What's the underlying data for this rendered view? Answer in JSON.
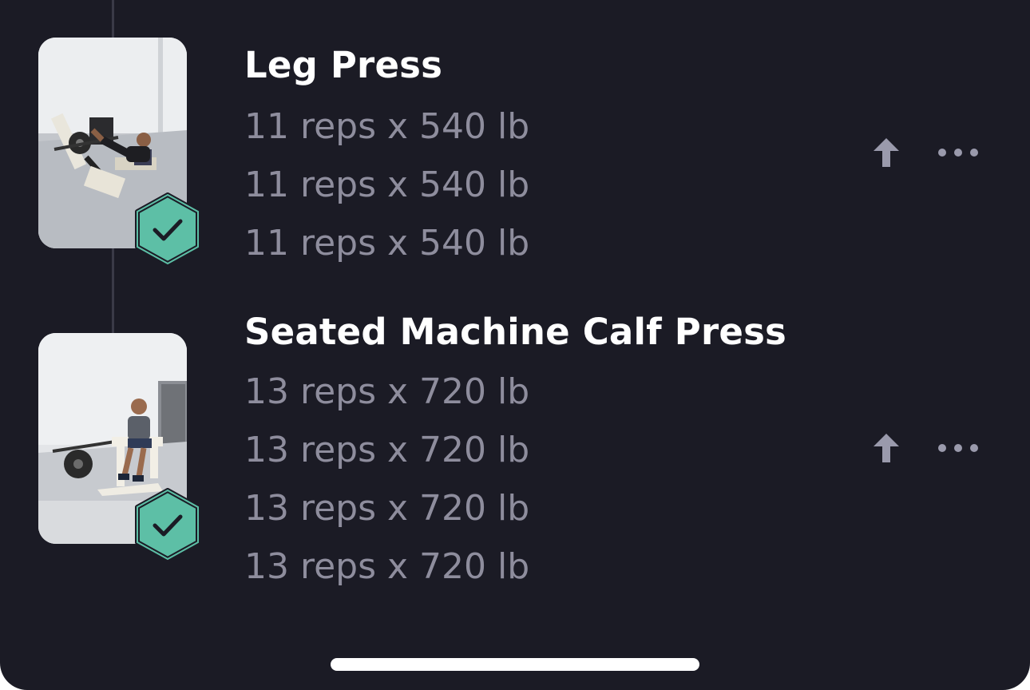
{
  "colors": {
    "background": "#1b1b25",
    "title": "#ffffff",
    "set_text": "#8e8d9d",
    "icon": "#9a9aac",
    "badge_fill": "#5dbfa6",
    "badge_outline": "#1b1b25"
  },
  "exercises": [
    {
      "name": "Leg Press",
      "thumbnail_icon": "leg-press-machine-photo",
      "completed_icon": "check-hexagon-icon",
      "sets": [
        "11 reps x 540 lb",
        "11 reps x 540 lb",
        "11 reps x 540 lb"
      ],
      "actions": [
        "arrow-up-icon",
        "more-horizontal-icon"
      ]
    },
    {
      "name": "Seated Machine Calf Press",
      "thumbnail_icon": "seated-calf-machine-photo",
      "completed_icon": "check-hexagon-icon",
      "sets": [
        "13 reps x 720 lb",
        "13 reps x 720 lb",
        "13 reps x 720 lb",
        "13 reps x 720 lb"
      ],
      "actions": [
        "arrow-up-icon",
        "more-horizontal-icon"
      ]
    }
  ]
}
